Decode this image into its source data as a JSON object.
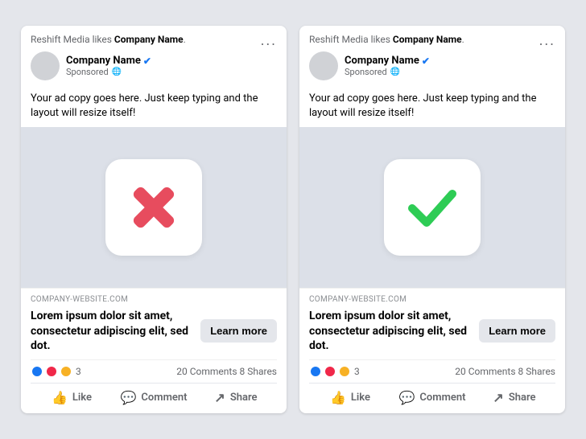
{
  "card1": {
    "likes_bar": "Reshift Media likes ",
    "company_bold": "Company Name",
    "more_dots": "...",
    "profile_name": "Company Name",
    "sponsored": "Sponsored",
    "ad_copy": "Your ad copy goes here. Just keep typing and the layout will resize itself!",
    "website_url": "COMPANY-WEBSITE.COM",
    "headline": "Lorem ipsum dolor sit amet, consectetur adipiscing elit, sed dot.",
    "learn_more": "Learn more",
    "reaction_count": "3",
    "comments_shares": "20 Comments  8 Shares",
    "like_label": "Like",
    "comment_label": "Comment",
    "share_label": "Share",
    "icon_type": "cross"
  },
  "card2": {
    "likes_bar": "Reshift Media likes ",
    "company_bold": "Company Name",
    "more_dots": "...",
    "profile_name": "Company Name",
    "sponsored": "Sponsored",
    "ad_copy": "Your ad copy goes here. Just keep typing and the layout will resize itself!",
    "website_url": "COMPANY-WEBSITE.COM",
    "headline": "Lorem ipsum dolor sit amet, consectetur adipiscing elit, sed dot.",
    "learn_more": "Learn more",
    "reaction_count": "3",
    "comments_shares": "20 Comments  8 Shares",
    "like_label": "Like",
    "comment_label": "Comment",
    "share_label": "Share",
    "icon_type": "check"
  }
}
